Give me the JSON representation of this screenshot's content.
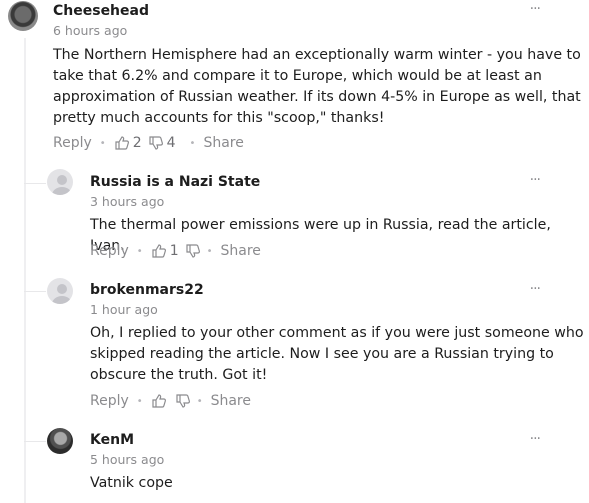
{
  "comments": [
    {
      "author": "Cheesehead",
      "time": "6 hours ago",
      "text_lines": [
        "The Northern Hemisphere had an exceptionally warm winter - you have to",
        "take that 6.2% and compare it to Europe, which would be at least an",
        "approximation of Russian weather. If its down 4-5% in Europe as well, that",
        "pretty much accounts for this \"scoop,\" thanks!"
      ],
      "reply_label": "Reply",
      "likes": "2",
      "dislikes": "4",
      "share_label": "Share",
      "more": "···"
    },
    {
      "author": "Russia is a Nazi State",
      "time": "3 hours ago",
      "text_lines": [
        "The thermal power emissions were up in Russia, read the article, Ivan."
      ],
      "reply_label": "Reply",
      "likes": "1",
      "dislikes": "",
      "share_label": "Share",
      "more": "···"
    },
    {
      "author": "brokenmars22",
      "time": "1 hour ago",
      "text_lines": [
        "Oh, I replied to your other comment as if you were just someone who",
        "skipped reading the article. Now I see you are a Russian trying to",
        "obscure the truth. Got it!"
      ],
      "reply_label": "Reply",
      "likes": "",
      "dislikes": "",
      "share_label": "Share",
      "more": "···"
    },
    {
      "author": "KenM",
      "time": "5 hours ago",
      "text_lines": [
        "Vatnik cope"
      ],
      "more": "···"
    }
  ],
  "icons": {
    "like": "thumbs-up-icon",
    "dislike": "thumbs-down-icon",
    "more": "more-dots-icon"
  }
}
